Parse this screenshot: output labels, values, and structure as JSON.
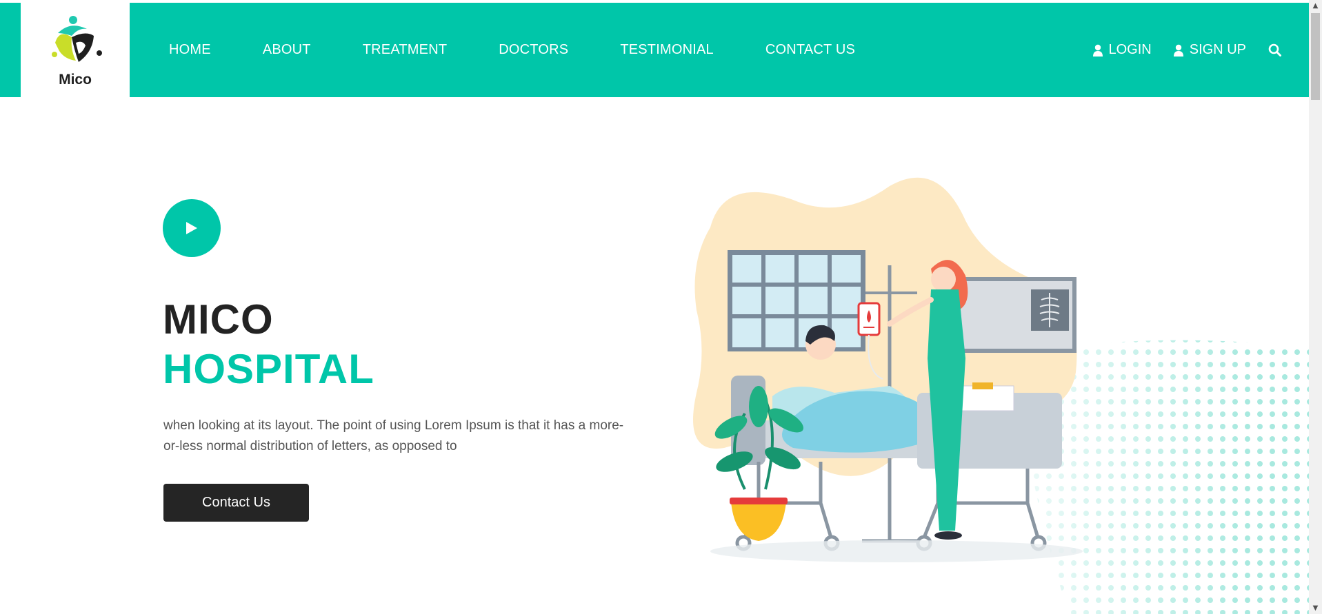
{
  "brand": {
    "name": "Mico"
  },
  "nav": {
    "items": [
      {
        "label": "HOME"
      },
      {
        "label": "ABOUT"
      },
      {
        "label": "TREATMENT"
      },
      {
        "label": "DOCTORS"
      },
      {
        "label": "TESTIMONIAL"
      },
      {
        "label": "CONTACT US"
      }
    ],
    "login_label": "LOGIN",
    "signup_label": "SIGN UP"
  },
  "hero": {
    "title_line1": "MICO",
    "title_line2": "HOSPITAL",
    "description": "when looking at its layout. The point of using Lorem Ipsum is that it has a more-or-less normal distribution of letters, as opposed to",
    "cta_label": "Contact Us"
  },
  "colors": {
    "accent": "#00c6a9",
    "dark": "#252525",
    "blob": "#fde9c4"
  },
  "icons": [
    "user-icon",
    "search-icon",
    "play-icon"
  ]
}
